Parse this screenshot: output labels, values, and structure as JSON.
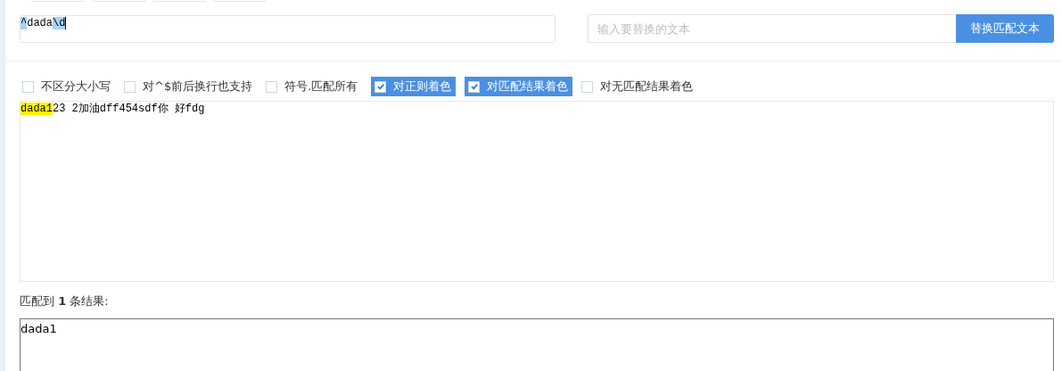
{
  "top_buttons": [
    {
      "kind": "cut"
    },
    {
      "kind": "cut"
    },
    {
      "kind": "cut"
    },
    {
      "kind": "cut"
    }
  ],
  "regex_field": {
    "segments": [
      {
        "text": "^",
        "highlighted": true
      },
      {
        "text": "dada",
        "highlighted": false
      },
      {
        "text": "\\d",
        "highlighted": true
      }
    ]
  },
  "replace_field": {
    "placeholder": "输入要替换的文本"
  },
  "replace_button": "替换匹配文本",
  "options": [
    {
      "label": "不区分大小写",
      "checked": false
    },
    {
      "label": "对^$前后换行也支持",
      "checked": false
    },
    {
      "label": "符号.匹配所有",
      "checked": false
    },
    {
      "label": "对正则着色",
      "checked": true
    },
    {
      "label": "对匹配结果着色",
      "checked": true
    },
    {
      "label": "对无匹配结果着色",
      "checked": false
    }
  ],
  "editor": {
    "segments": [
      {
        "text": "dada1",
        "highlighted": true
      },
      {
        "text": "23 2加油dff454sdf你 好fdg",
        "highlighted": false
      }
    ]
  },
  "summary": "匹配到 **1** 条结果:",
  "result_box": {
    "value": "dada1"
  }
}
